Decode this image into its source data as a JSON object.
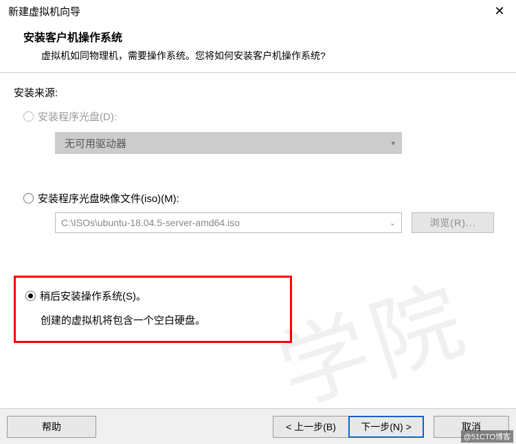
{
  "titlebar": {
    "title": "新建虚拟机向导",
    "close": "✕"
  },
  "header": {
    "title": "安装客户机操作系统",
    "subtitle": "虚拟机如同物理机，需要操作系统。您将如何安装客户机操作系统?"
  },
  "content": {
    "source_label": "安装来源:",
    "option_disc": {
      "label": "安装程序光盘(D):",
      "dropdown_text": "无可用驱动器"
    },
    "option_iso": {
      "label": "安装程序光盘映像文件(iso)(M):",
      "path": "C:\\ISOs\\ubuntu-18.04.5-server-amd64.iso",
      "browse": "浏览(R)..."
    },
    "option_later": {
      "label": "稍后安装操作系统(S)。",
      "desc": "创建的虚拟机将包含一个空白硬盘。"
    }
  },
  "footer": {
    "help": "帮助",
    "back": "< 上一步(B)",
    "next": "下一步(N) >",
    "cancel": "取消"
  },
  "watermark": "学院",
  "corner": "@51CTO博客"
}
